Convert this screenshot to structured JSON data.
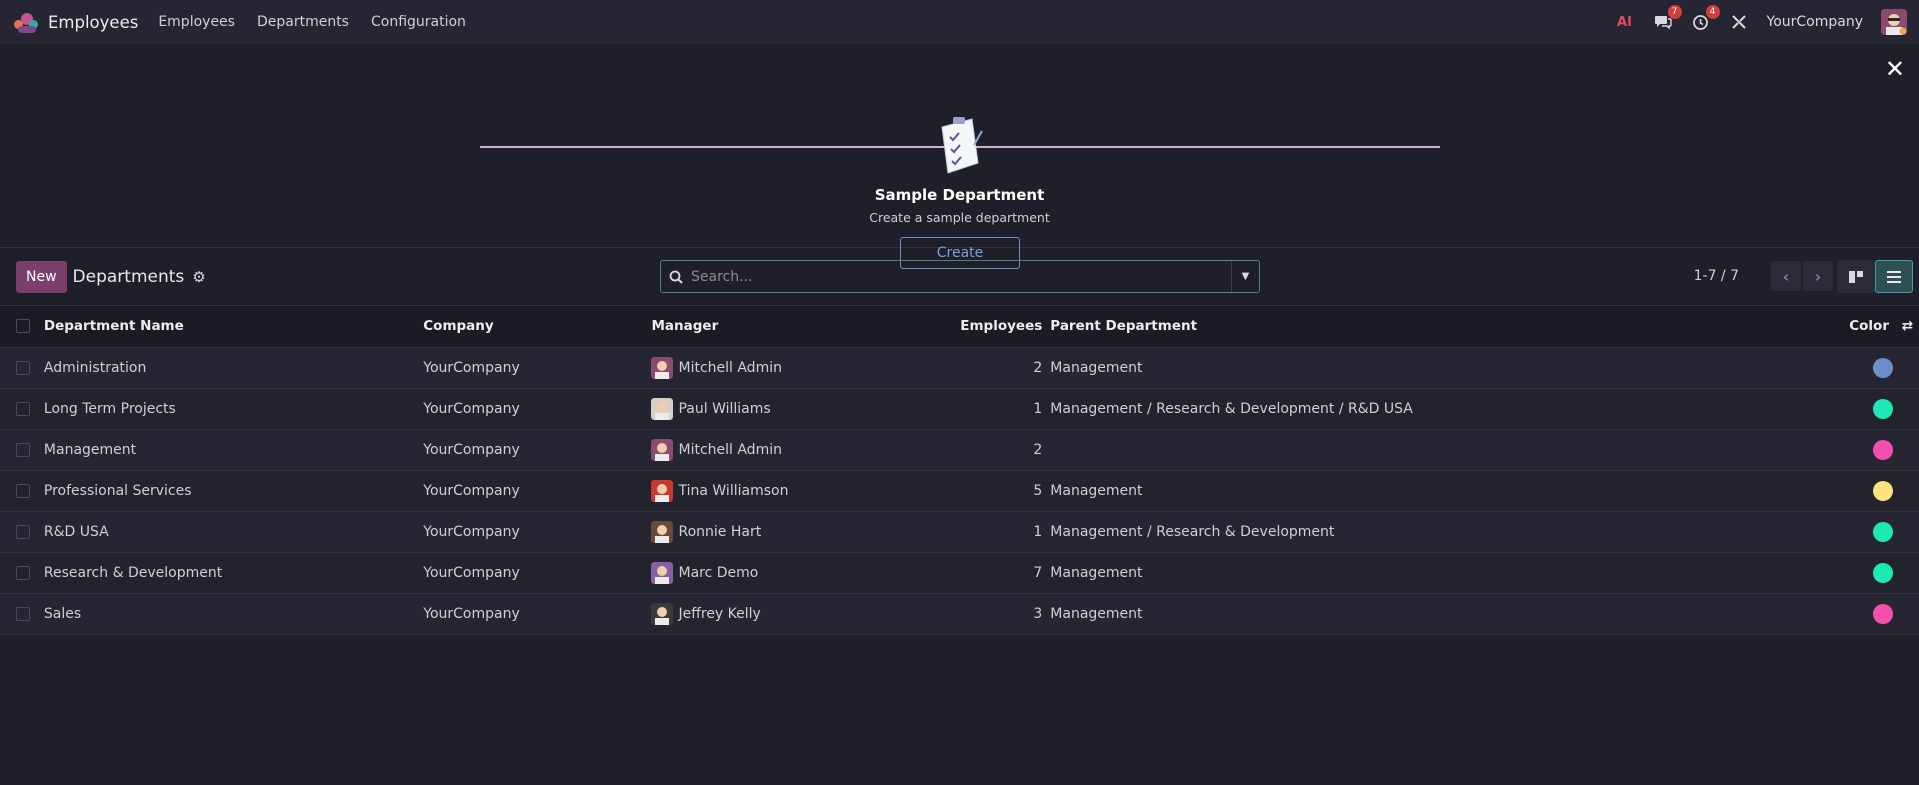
{
  "nav": {
    "brand": "Employees",
    "menu": [
      "Employees",
      "Departments",
      "Configuration"
    ],
    "ai_label": "AI",
    "messages_count": "7",
    "activities_count": "4",
    "company": "YourCompany"
  },
  "banner": {
    "title": "Sample Department",
    "subtitle": "Create a sample department",
    "create_label": "Create"
  },
  "control": {
    "new_label": "New",
    "breadcrumb": "Departments",
    "search_placeholder": "Search...",
    "pager": "1-7 / 7"
  },
  "table": {
    "headers": {
      "name": "Department Name",
      "company": "Company",
      "manager": "Manager",
      "employees": "Employees",
      "parent": "Parent Department",
      "color": "Color"
    },
    "rows": [
      {
        "name": "Administration",
        "company": "YourCompany",
        "manager": "Mitchell Admin",
        "employees": "2",
        "parent": "Management",
        "color": "#6c8ec9"
      },
      {
        "name": "Long Term Projects",
        "company": "YourCompany",
        "manager": "Paul Williams",
        "employees": "1",
        "parent": "Management / Research & Development / R&D USA",
        "color": "#1de9b6"
      },
      {
        "name": "Management",
        "company": "YourCompany",
        "manager": "Mitchell Admin",
        "employees": "2",
        "parent": "",
        "color": "#f44faf"
      },
      {
        "name": "Professional Services",
        "company": "YourCompany",
        "manager": "Tina Williamson",
        "employees": "5",
        "parent": "Management",
        "color": "#fce37a"
      },
      {
        "name": "R&D USA",
        "company": "YourCompany",
        "manager": "Ronnie Hart",
        "employees": "1",
        "parent": "Management / Research & Development",
        "color": "#1de9b6"
      },
      {
        "name": "Research & Development",
        "company": "YourCompany",
        "manager": "Marc Demo",
        "employees": "7",
        "parent": "Management",
        "color": "#1de9b6"
      },
      {
        "name": "Sales",
        "company": "YourCompany",
        "manager": "Jeffrey Kelly",
        "employees": "3",
        "parent": "Management",
        "color": "#f44faf"
      }
    ]
  }
}
